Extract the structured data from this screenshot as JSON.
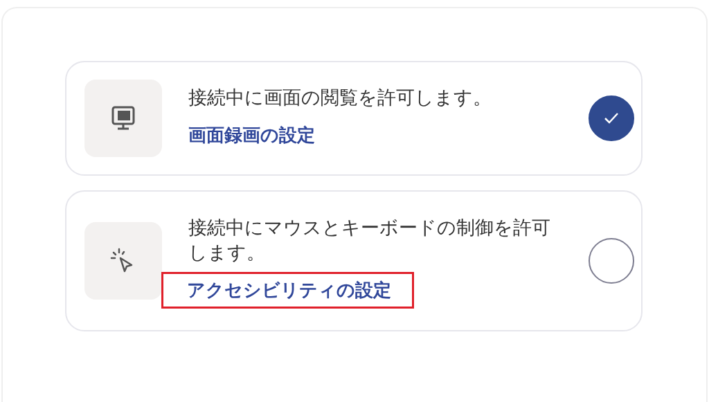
{
  "options": [
    {
      "kind": "screen",
      "text": "接続中に画面の閲覧を許可します。",
      "link": "画面録画の設定",
      "link_highlighted": false,
      "selected": true
    },
    {
      "kind": "pointer",
      "text": "接続中にマウスとキーボードの制御を許可します。",
      "link": "アクセシビリティの設定",
      "link_highlighted": true,
      "selected": false
    }
  ]
}
